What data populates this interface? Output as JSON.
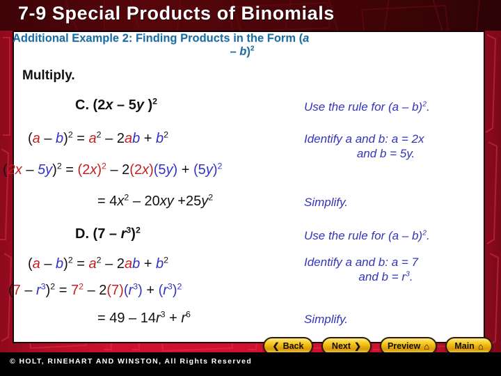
{
  "slide": {
    "title": "7-9  Special Products of Binomials",
    "heading_line1": "Additional Example 2: Finding Products in the Form (a",
    "heading_line2_pre": "– b",
    "heading_line2_sup": "2",
    "instruction": "Multiply."
  },
  "problems": [
    {
      "id": "C",
      "label_prefix": "C. (2",
      "label": "C. (2x – 5y )2",
      "rule_line": "(a – b)2 = a2 – 2ab + b2",
      "substitution": "(2x – 5y)2 = (2x)2 – 2(2x)(5y) + (5y)2",
      "result": "= 4x2 – 20xy +25y2",
      "notes": [
        "Use the rule for (a – b)2.",
        "Identify a and b: a = 2x",
        "and b = 5y.",
        "Simplify."
      ]
    },
    {
      "id": "D",
      "label": "D. (7 – r3)2",
      "rule_line": "(a – b)2 = a2 – 2ab + b2",
      "substitution": "(7 – r3)2 = 72 – 2(7)(r3) + (r3)2",
      "result": "= 49 – 14r3 + r6",
      "notes": [
        "Use the rule for (a – b)2.",
        "Identify a and b: a = 7",
        "and b = r3.",
        "Simplify."
      ]
    }
  ],
  "nav": {
    "back": "Back",
    "next": "Next",
    "preview": "Preview",
    "main": "Main",
    "back_icon": "chevron-left-icon",
    "next_icon": "chevron-right-icon",
    "preview_icon": "home-icon",
    "main_icon": "home-icon"
  },
  "footer": {
    "copyright": "© HOLT, RINEHART AND WINSTON, All Rights Reserved"
  },
  "colors": {
    "title_band": "#3d0407",
    "frame_red": "#d1102f",
    "heading_blue": "#1a6ea6",
    "note_blue": "#3333bb",
    "term_a_red": "#c41f23",
    "term_b_blue": "#3333c4",
    "button_gold": "#f5c518"
  }
}
